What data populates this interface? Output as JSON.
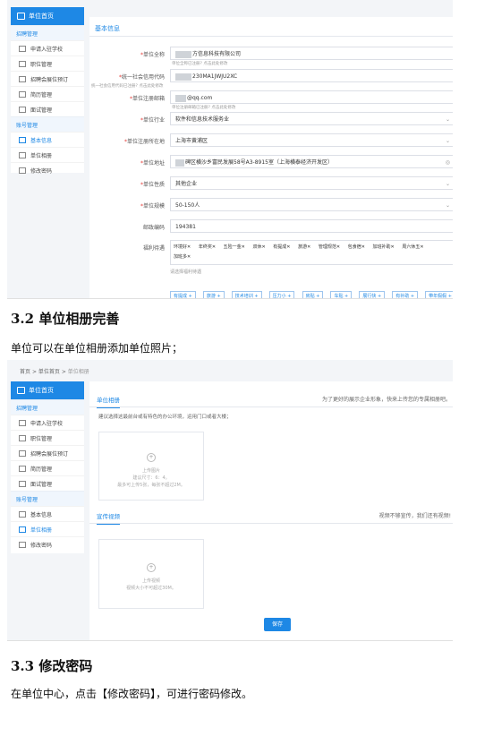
{
  "screen1": {
    "sidebar": {
      "home_label": "单位首页",
      "sections": [
        {
          "title": "招聘管理",
          "items": [
            "申请入驻学校",
            "职位管理",
            "招聘会展位预订",
            "简历管理",
            "面试管理"
          ]
        },
        {
          "title": "账号管理",
          "items": [
            "基本信息",
            "单位相册",
            "修改密码"
          ]
        }
      ],
      "active_item": "基本信息"
    },
    "section_title": "基本信息",
    "fields": [
      {
        "label": "单位全称",
        "value": "方信息科技有限公司",
        "hint": "单位全称已注册? 点击此处修改",
        "required": true
      },
      {
        "label": "统一社会信用代码",
        "value": "230MA1JWJU2XC",
        "hint": "统一社会信用代码已注册? 点击此处修改",
        "required": true
      },
      {
        "label": "单位注册邮箱",
        "value": "@qq.com",
        "hint": "单位注册邮箱已注册? 点击此处修改",
        "required": true
      },
      {
        "label": "单位行业",
        "value": "软件和信息技术服务业",
        "required": true
      },
      {
        "label": "单位注册所在地",
        "value": "上海市黄浦区",
        "required": true
      },
      {
        "label": "单位地址",
        "value": "碑区横沙乡富民发展58号A3-8915室（上海横泰经济开发区）",
        "required": true
      },
      {
        "label": "单位性质",
        "value": "其他企业",
        "required": true
      },
      {
        "label": "单位规模",
        "value": "50-150人",
        "required": true
      },
      {
        "label": "邮政编码",
        "value": "194381",
        "required": false
      }
    ],
    "welfare": {
      "label": "福利待遇",
      "selected": [
        "环境好",
        "年终奖",
        "五险一金",
        "双休",
        "有提成",
        "旅游",
        "管理规范",
        "包食宿",
        "加班补助",
        "周六休五",
        "加班多"
      ],
      "remove_mark": "✕",
      "placeholder": "请选择福利待遇",
      "options": [
        "有提成",
        "旅游",
        "技术培训",
        "压力小",
        "房贴",
        "车贴",
        "展行快",
        "有补助",
        "带年假假"
      ]
    }
  },
  "doc": {
    "heading_3_2": "3.2 单位相册完善",
    "text_3_2": "单位可以在单位相册添加单位照片；",
    "heading_3_3": "3.3 修改密码",
    "text_3_3": "在单位中心，点击【修改密码】，可进行密码修改。"
  },
  "screen2": {
    "breadcrumb": [
      "首页",
      "单位首页",
      "单位相册"
    ],
    "breadcrumb_sep": ">",
    "sidebar": {
      "home_label": "单位首页",
      "sections": [
        {
          "title": "招聘管理",
          "items": [
            "申请入驻学校",
            "职位管理",
            "招聘会展位预订",
            "简历管理",
            "面试管理"
          ]
        },
        {
          "title": "账号管理",
          "items": [
            "基本信息",
            "单位相册",
            "修改密码"
          ]
        }
      ],
      "active_item": "单位相册"
    },
    "album_tab": "单位相册",
    "album_note": "为了更好的展示企业形象，快来上传您的专属相册吧。",
    "album_tip": "建议选择这最前台或有特色的办公环境，运用门口或者大楼；",
    "photo_upload": {
      "title": "上传图片",
      "line1": "建议尺寸：6：4。",
      "line2": "最多可上传5张，每张不超过2M。"
    },
    "video_tab": "宣传视频",
    "video_note": "视频不够宣传，我们还有视频!",
    "video_upload": {
      "title": "上传视频",
      "line1": "视频大小不可超过30M。"
    },
    "save_label": "保存"
  }
}
